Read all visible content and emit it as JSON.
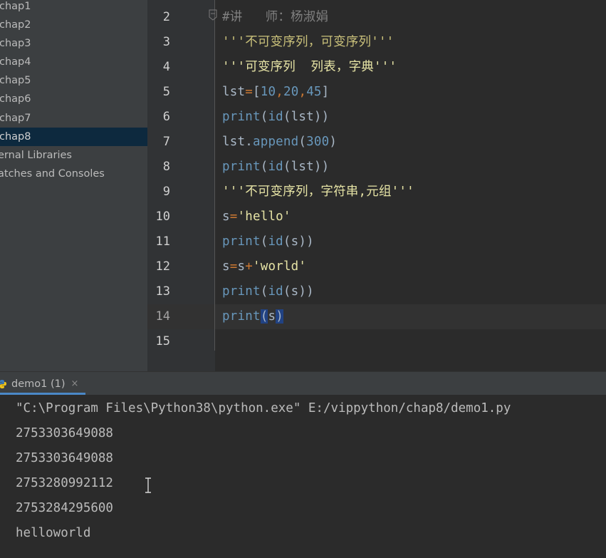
{
  "sidebar": {
    "items": [
      {
        "label": "chap1"
      },
      {
        "label": "chap2"
      },
      {
        "label": "chap3"
      },
      {
        "label": "chap4"
      },
      {
        "label": "chap5"
      },
      {
        "label": "chap6"
      },
      {
        "label": "chap7"
      },
      {
        "label": "chap8",
        "selected": true
      },
      {
        "label": "ernal Libraries"
      },
      {
        "label": "atches and Consoles"
      }
    ]
  },
  "editor": {
    "line_numbers": [
      "2",
      "3",
      "4",
      "5",
      "6",
      "7",
      "8",
      "9",
      "10",
      "11",
      "12",
      "13",
      "14",
      "15"
    ],
    "current_line": "14",
    "code": {
      "l2": "#讲   师：杨淑娟",
      "l3": "'''不可变序列，可变序列'''",
      "l4": "'''可变序列  列表，字典'''",
      "l5_a": "lst",
      "l5_b": "=",
      "l5_c": "[",
      "l5_d": "10",
      "l5_e": ",",
      "l5_f": "20",
      "l5_g": ",",
      "l5_h": "45",
      "l5_i": "]",
      "print": "print",
      "id": "id",
      "lst": "lst",
      "append": "append",
      "n300": "300",
      "l9": "'''不可变序列，字符串,元组'''",
      "s": "s",
      "eq": "=",
      "hello": "'hello'",
      "plus": "+",
      "world": "'world'",
      "dot": ".",
      "lp": "(",
      "rp": ")",
      "rpp": "))"
    }
  },
  "run": {
    "tab_label": "demo1 (1)",
    "close_glyph": "×",
    "icon": "python-icon",
    "output": [
      "\"C:\\Program Files\\Python38\\python.exe\" E:/vippython/chap8/demo1.py",
      "2753303649088",
      "2753303649088",
      "2753280992112",
      "2753284295600",
      "helloworld"
    ]
  },
  "colors": {
    "sidebar_bg": "#3c3f41",
    "selection_bg": "#0d293e",
    "editor_bg": "#2b2b2b",
    "accent": "#4a88c7"
  }
}
